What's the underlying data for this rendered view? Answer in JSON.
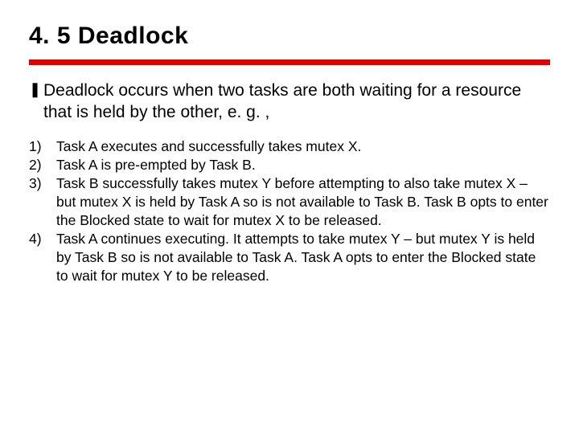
{
  "title": "4. 5 Deadlock",
  "intro": "Deadlock occurs when two tasks are both waiting for a resource that is held by the other, e. g. ,",
  "steps": [
    {
      "num": "1)",
      "text": "Task A executes and successfully takes mutex X."
    },
    {
      "num": "2)",
      "text": "Task A is pre-empted by Task B."
    },
    {
      "num": "3)",
      "text": "Task B successfully takes mutex Y before attempting to also take mutex X – but mutex X is held by Task A so is not available to Task B. Task B opts to enter the Blocked state to wait for mutex X to be released."
    },
    {
      "num": "4)",
      "text": "Task A continues executing. It attempts to take mutex Y – but mutex Y is held by Task B so is not available to Task A. Task A opts to enter the Blocked state to wait for mutex Y to be released."
    }
  ]
}
